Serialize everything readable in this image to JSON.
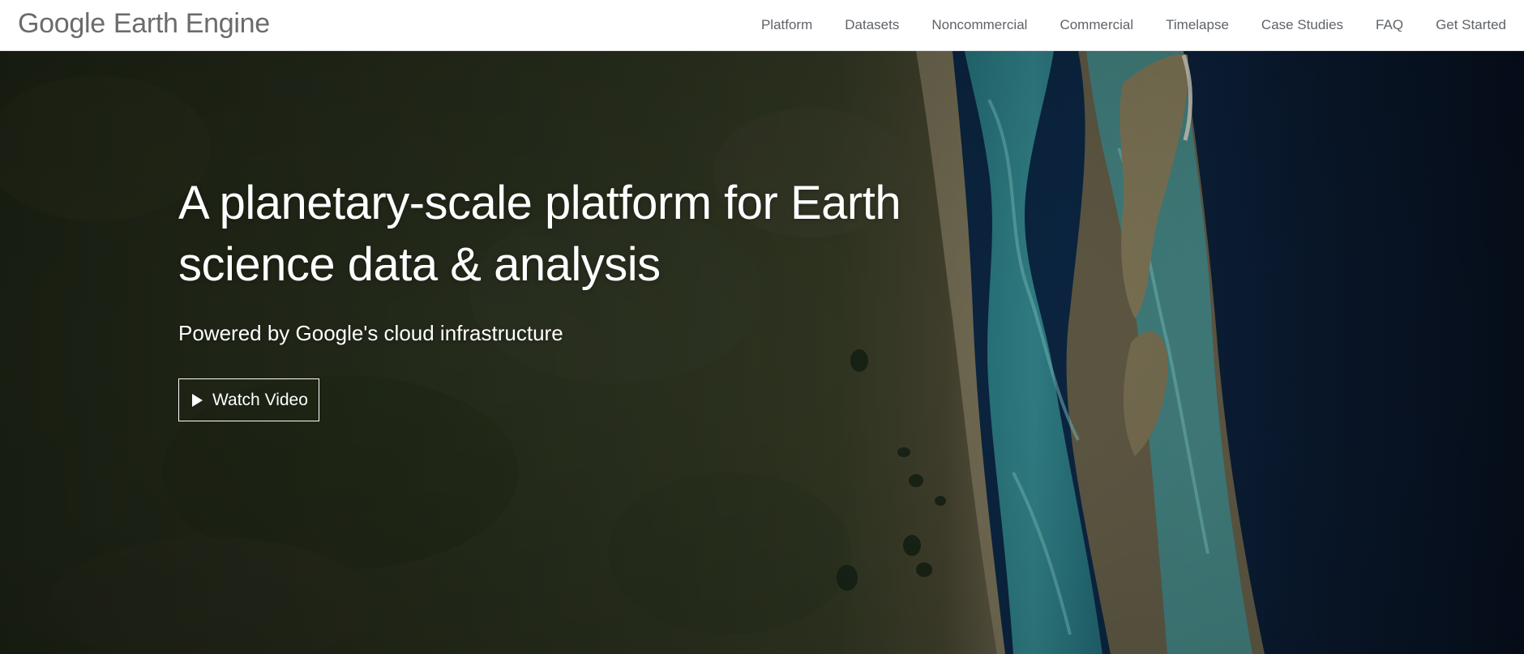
{
  "header": {
    "brand_google": "Google",
    "brand_product": "Earth Engine",
    "nav": [
      {
        "label": "Platform"
      },
      {
        "label": "Datasets"
      },
      {
        "label": "Noncommercial"
      },
      {
        "label": "Commercial"
      },
      {
        "label": "Timelapse"
      },
      {
        "label": "Case Studies"
      },
      {
        "label": "FAQ"
      },
      {
        "label": "Get Started"
      }
    ]
  },
  "hero": {
    "title_line1": "A planetary-scale platform for Earth",
    "title_line2": "science data & analysis",
    "subtitle": "Powered by Google's cloud infrastructure",
    "watch_video_label": "Watch Video",
    "play_icon": "play-icon",
    "background": "satellite-image"
  },
  "colors": {
    "nav_text": "#5f6368",
    "brand_text": "#6b6b6b",
    "hero_text": "#ffffff",
    "land_dark": "#2c3520",
    "water_teal": "#3a9a9e",
    "ocean_deep": "#0b1a2e"
  }
}
